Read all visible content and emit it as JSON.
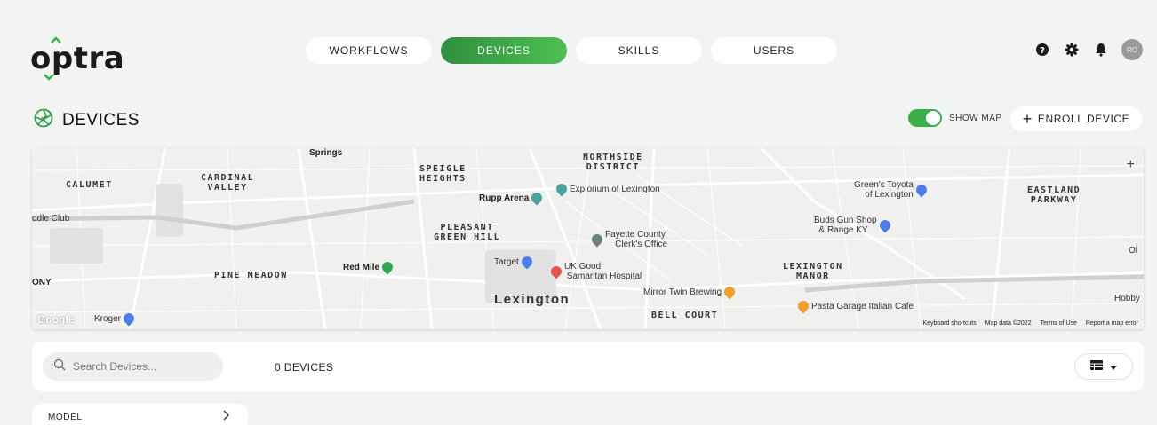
{
  "brand": {
    "logo_text": "optra",
    "accent": "#3bb04a"
  },
  "nav": {
    "tabs": [
      {
        "label": "WORKFLOWS",
        "active": false
      },
      {
        "label": "DEVICES",
        "active": true
      },
      {
        "label": "SKILLS",
        "active": false
      },
      {
        "label": "USERS",
        "active": false
      }
    ]
  },
  "header_icons": [
    "help-icon",
    "gear-icon",
    "bell-icon"
  ],
  "user": {
    "initials": "RO"
  },
  "page": {
    "title": "DEVICES",
    "icon": "aperture-icon"
  },
  "map_toggle": {
    "label": "SHOW MAP",
    "on": true
  },
  "enroll": {
    "label": "ENROLL DEVICE"
  },
  "map": {
    "neighborhoods": [
      "CALUMET",
      "CARDINAL\nVALLEY",
      "SPEIGLE\nHEIGHTS",
      "NORTHSIDE\nDISTRICT",
      "EASTLAND\nPARKWAY",
      "PLEASANT\nGREEN HILL",
      "PINE MEADOW",
      "LEXINGTON\nMANOR",
      "BELL COURT"
    ],
    "places": [
      "Springs",
      "Rupp Arena",
      "Explorium of Lexington",
      "Green's Toyota\nof Lexington",
      "Buds Gun Shop\n& Range KY",
      "Fayette County\nClerk's Office",
      "Target",
      "UK Good\nSamaritan Hospital",
      "Mirror Twin Brewing",
      "Pasta Garage Italian Cafe",
      "Red Mile",
      "Kroger",
      "ddle Club",
      "ONY",
      "Ol",
      "Hobby"
    ],
    "city": "Lexington",
    "footer": [
      "Keyboard shortcuts",
      "Map data ©2022",
      "Terms of Use",
      "Report a map error"
    ],
    "attribution": "Google"
  },
  "toolbar": {
    "search_placeholder": "Search Devices...",
    "device_count": "0 DEVICES"
  },
  "filter": {
    "label": "MODEL"
  }
}
